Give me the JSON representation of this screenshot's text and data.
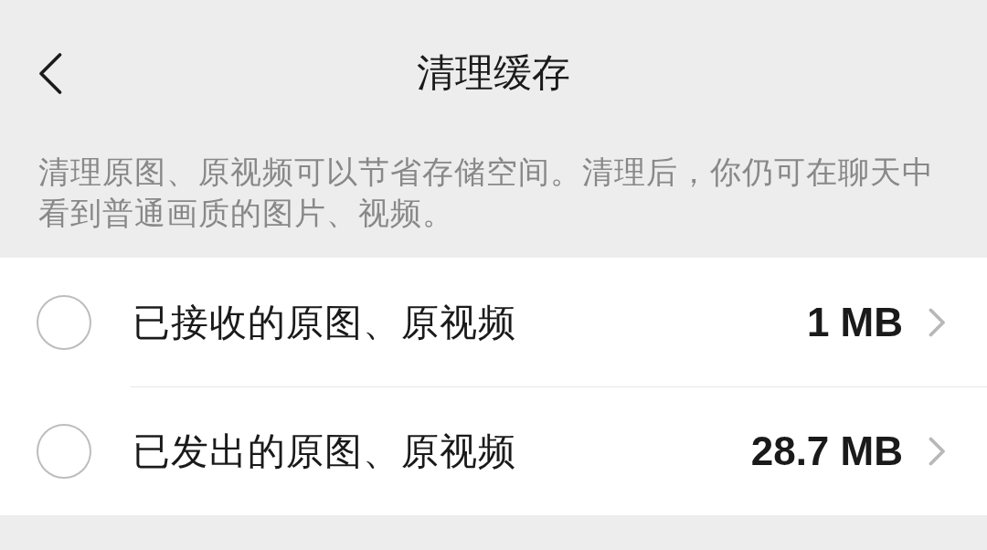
{
  "header": {
    "title": "清理缓存"
  },
  "description": "清理原图、原视频可以节省存储空间。清理后，你仍可在聊天中看到普通画质的图片、视频。",
  "items": [
    {
      "label": "已接收的原图、原视频",
      "size": "1 MB",
      "selected": false
    },
    {
      "label": "已发出的原图、原视频",
      "size": "28.7 MB",
      "selected": false
    }
  ]
}
